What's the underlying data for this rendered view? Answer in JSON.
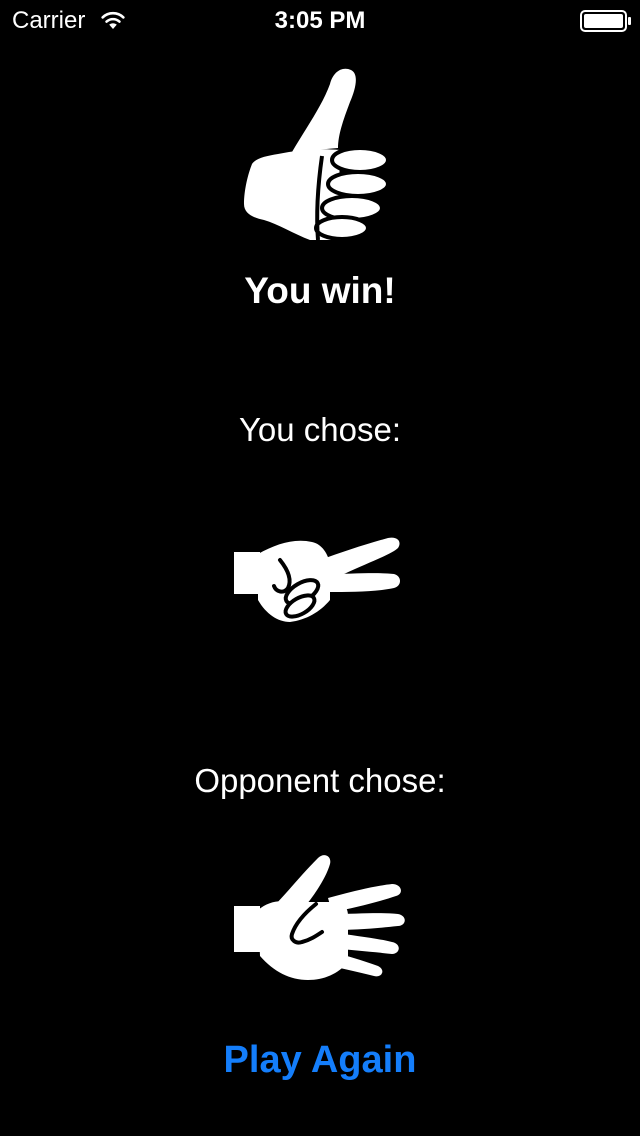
{
  "status_bar": {
    "carrier": "Carrier",
    "time": "3:05 PM",
    "wifi_icon": "wifi-icon",
    "battery_icon": "battery-icon"
  },
  "result": {
    "icon": "thumbs-up-icon",
    "title": "You win!"
  },
  "player": {
    "label": "You chose:",
    "icon": "scissors-hand-icon"
  },
  "opponent": {
    "label": "Opponent chose:",
    "icon": "paper-hand-icon"
  },
  "actions": {
    "play_again_label": "Play Again"
  },
  "colors": {
    "background": "#000000",
    "text": "#ffffff",
    "accent": "#147EFB"
  }
}
